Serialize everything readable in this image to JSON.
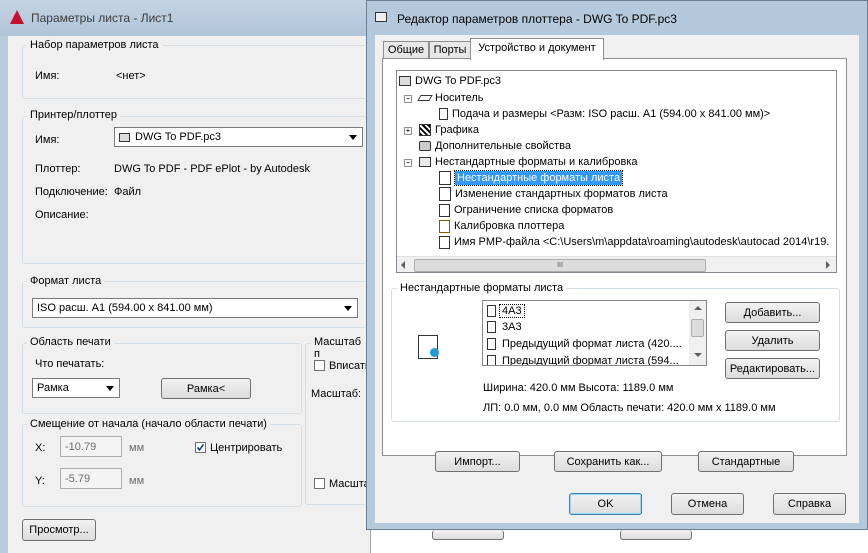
{
  "left_dialog": {
    "title": "Параметры листа - Лист1",
    "page_setup": {
      "group_title": "Набор параметров листа",
      "name_label": "Имя:",
      "name_value": "<нет>"
    },
    "printer": {
      "group_title": "Принтер/плоттер",
      "name_label": "Имя:",
      "name_value": "DWG To PDF.pc3",
      "plotter_label": "Плоттер:",
      "plotter_value": "DWG To PDF - PDF ePlot - by Autodesk",
      "connection_label": "Подключение:",
      "connection_value": "Файл",
      "description_label": "Описание:"
    },
    "paper_size": {
      "group_title": "Формат листа",
      "value": "ISO расш. A1 (594.00 x 841.00 мм)"
    },
    "plot_area": {
      "group_title": "Область печати",
      "what_label": "Что печатать:",
      "what_value": "Рамка",
      "window_button": "Рамка<"
    },
    "plot_scale": {
      "group_title": "Масштаб п",
      "fit_label": "Вписать",
      "scale_label": "Масштаб:",
      "lineweights_label": "Масшта"
    },
    "plot_offset": {
      "group_title": "Смещение от начала (начало области печати)",
      "x_label": "X:",
      "x_value": "-10.79",
      "x_unit": "мм",
      "y_label": "Y:",
      "y_value": "-5.79",
      "y_unit": "мм",
      "center_label": "Центрировать",
      "center_checked": true
    },
    "preview_button": "Просмотр..."
  },
  "editor": {
    "title": "Редактор параметров плоттера - DWG To PDF.pc3",
    "tabs": [
      "Общие",
      "Порты",
      "Устройство и документ"
    ],
    "active_tab": 2,
    "tree": [
      {
        "label": "DWG To PDF.pc3",
        "icon": "plotter-icon"
      },
      {
        "label": "Носитель",
        "icon": "media-icon",
        "expander": "−"
      },
      {
        "label": "Подача и размеры <Разм: ISO расш. A1 (594.00 x 841.00 мм)>",
        "icon": "document-icon"
      },
      {
        "label": "Графика",
        "icon": "graphics-icon",
        "expander": "+"
      },
      {
        "label": "Дополнительные свойства",
        "icon": "properties-icon"
      },
      {
        "label": "Нестандартные форматы и калибровка",
        "icon": "calibration-icon",
        "expander": "−"
      },
      {
        "label": "Нестандартные форматы листа",
        "icon": "custom-paper-icon",
        "selected": true
      },
      {
        "label": "Изменение стандартных форматов листа",
        "icon": "modify-paper-icon"
      },
      {
        "label": "Ограничение списка форматов",
        "icon": "filter-paper-icon"
      },
      {
        "label": "Калибровка плоттера",
        "icon": "plotter-calibration-icon"
      },
      {
        "label": "Имя PMP-файла <C:\\Users\\m\\appdata\\roaming\\autodesk\\autocad 2014\\r19.",
        "icon": "pmp-file-icon"
      }
    ],
    "custom_sizes": {
      "group_title": "Нестандартные форматы листа",
      "list": [
        "4A3",
        "3A3",
        "Предыдущий формат листа  (420....",
        "Предыдущий формат листа  (594..."
      ],
      "selected_index": 0,
      "add_button": "Добавить...",
      "delete_button": "Удалить",
      "edit_button": "Редактировать...",
      "info_line1": "Ширина: 420.0 мм  Высота: 1189.0 мм",
      "info_line2": "ЛП: 0.0 мм, 0.0 мм  Область печати: 420.0 мм x 1189.0 мм"
    },
    "import_button": "Импорт...",
    "save_as_button": "Сохранить как...",
    "defaults_button": "Стандартные",
    "ok_button": "OK",
    "cancel_button": "Отмена",
    "help_button": "Справка",
    "scroll_grip": "III"
  }
}
